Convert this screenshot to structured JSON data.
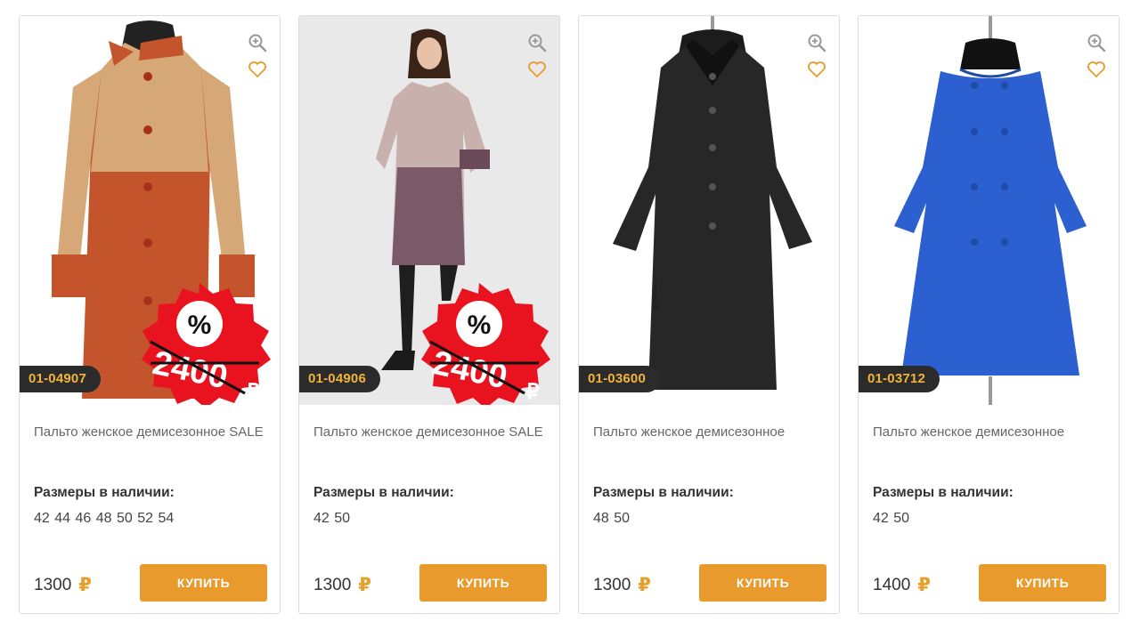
{
  "products": [
    {
      "sku": "01-04907",
      "title": "Пальто женское демисезонное SALE",
      "sizes_label": "Размеры в наличии:",
      "sizes": "42 44 46 48 50 52 54",
      "price": "1300",
      "currency": "₽",
      "buy_label": "КУПИТЬ",
      "sale_badge": {
        "percent": "%",
        "old_price": "2400",
        "currency": "₽"
      }
    },
    {
      "sku": "01-04906",
      "title": "Пальто женское демисезонное SALE",
      "sizes_label": "Размеры в наличии:",
      "sizes": "42 50",
      "price": "1300",
      "currency": "₽",
      "buy_label": "КУПИТЬ",
      "sale_badge": {
        "percent": "%",
        "old_price": "2400",
        "currency": "₽"
      }
    },
    {
      "sku": "01-03600",
      "title": "Пальто женское демисезонное",
      "sizes_label": "Размеры в наличии:",
      "sizes": "48 50",
      "price": "1300",
      "currency": "₽",
      "buy_label": "КУПИТЬ"
    },
    {
      "sku": "01-03712",
      "title": "Пальто женское демисезонное",
      "sizes_label": "Размеры в наличии:",
      "sizes": "42 50",
      "price": "1400",
      "currency": "₽",
      "buy_label": "КУПИТЬ"
    }
  ],
  "icons": {
    "zoom": "zoom-in-icon",
    "favorite": "heart-icon"
  },
  "colors": {
    "accent": "#e99a2c",
    "sku_bg": "#2b2b2b",
    "sku_text": "#f2b53a",
    "sale_red": "#e8131f"
  }
}
